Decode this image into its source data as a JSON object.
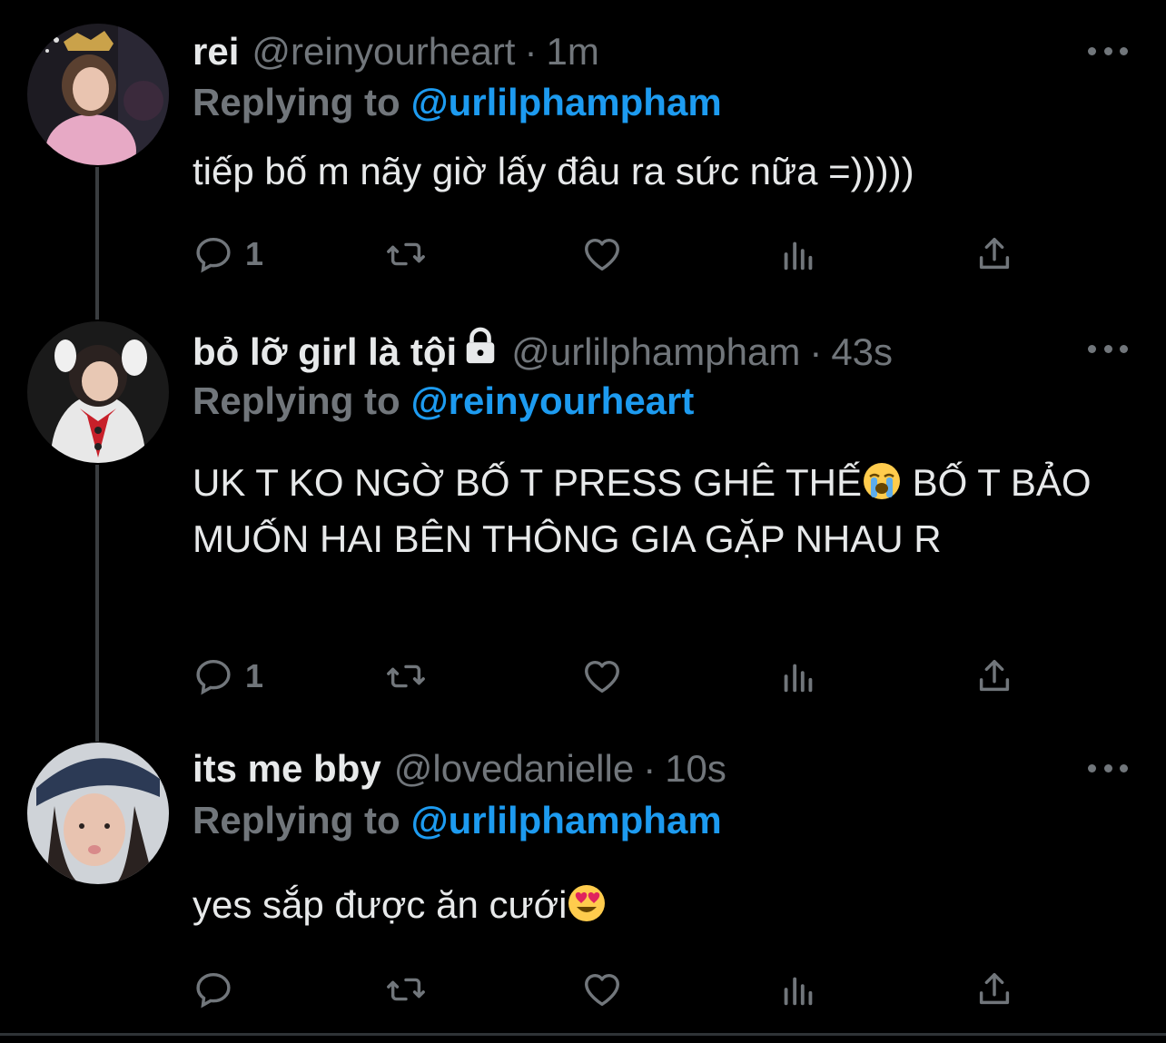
{
  "colors": {
    "background": "#000000",
    "text": "#e7e9ea",
    "muted": "#71767b",
    "link": "#1d9bf0",
    "thread_line": "#3a3d40"
  },
  "tweets": [
    {
      "name": "rei",
      "handle": "@reinyourheart",
      "dot": "·",
      "time": "1m",
      "replying_label": "Replying to",
      "replying_to": "@urlilphampham",
      "text": "tiếp bố m nãy giờ lấy đâu ra sức nữa =)))))",
      "reply_count": "1",
      "protected": false
    },
    {
      "name": "bỏ lỡ girl là tội",
      "handle": "@urlilphampham",
      "dot": "·",
      "time": "43s",
      "replying_label": "Replying to",
      "replying_to": "@reinyourheart",
      "text_part1": "UK T KO NGỜ BỐ T PRESS GHÊ THẾ",
      "text_part2": "  BỐ T BẢO MUỐN HAI BÊN THÔNG GIA GẶP NHAU R",
      "emoji": "loudly-crying-face",
      "reply_count": "1",
      "protected": true
    },
    {
      "name": "its me bby",
      "handle": "@lovedanielle",
      "dot": "·",
      "time": "10s",
      "replying_label": "Replying to",
      "replying_to": "@urlilphampham",
      "text": "yes sắp được ăn cưới",
      "emoji": "smiling-face-with-heart-eyes",
      "reply_count": "",
      "protected": false
    }
  ],
  "icons": {
    "reply": "reply-icon",
    "retweet": "retweet-icon",
    "like": "like-icon",
    "views": "views-icon",
    "share": "share-icon",
    "more": "more-icon",
    "lock": "lock-icon"
  }
}
